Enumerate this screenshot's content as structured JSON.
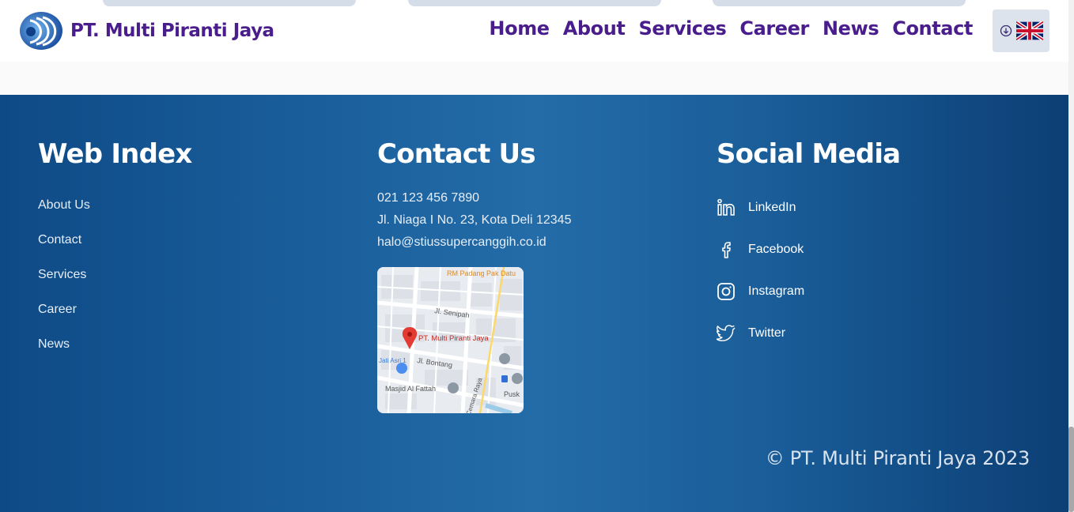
{
  "header": {
    "brand_name": "PT. Multi Piranti Jaya",
    "nav": [
      "Home",
      "About",
      "Services",
      "Career",
      "News",
      "Contact"
    ],
    "language_icon": "uk-flag-icon",
    "language_dropdown_icon": "download-circle-icon"
  },
  "footer": {
    "web_index": {
      "title": "Web Index",
      "links": [
        "About Us",
        "Contact",
        "Services",
        "Career",
        "News"
      ]
    },
    "contact": {
      "title": "Contact Us",
      "phone": "021 123 456 7890",
      "address": "Jl. Niaga I No. 23, Kota Deli 12345",
      "email": "halo@stiussupercanggih.co.id",
      "map": {
        "pin_label": "PT. Multi Piranti Jaya",
        "labels": [
          "RM Padang Pak Datu",
          "Jl. Senipah",
          "Jl. Bontang",
          "Masjid Al Fattah",
          "Jati Asri 1",
          "Cemara Raya",
          "Pusk"
        ]
      }
    },
    "social": {
      "title": "Social Media",
      "items": [
        {
          "label": "LinkedIn",
          "icon": "linkedin-icon"
        },
        {
          "label": "Facebook",
          "icon": "facebook-icon"
        },
        {
          "label": "Instagram",
          "icon": "instagram-icon"
        },
        {
          "label": "Twitter",
          "icon": "twitter-icon"
        }
      ]
    },
    "copyright": "© PT. Multi Piranti Jaya 2023"
  },
  "colors": {
    "brand_purple": "#4a1d8c",
    "footer_blue": "#1a5f9c"
  }
}
